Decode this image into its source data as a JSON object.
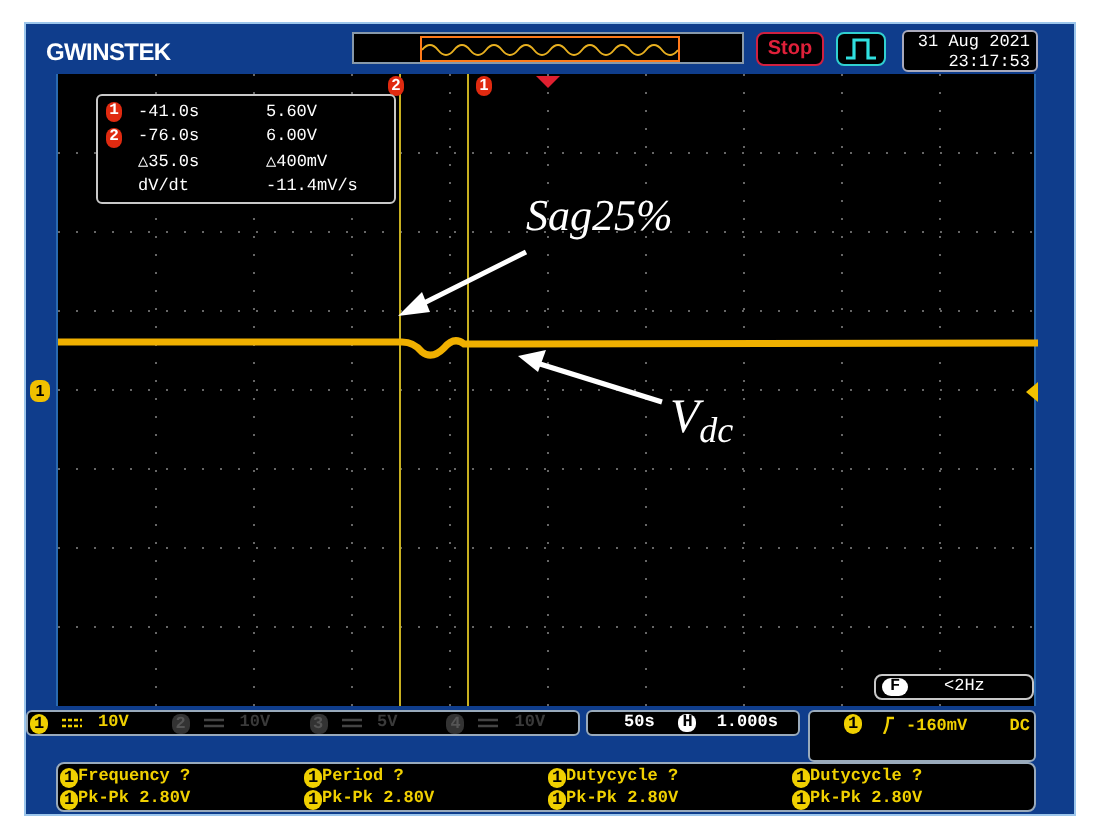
{
  "header": {
    "brand": "GWINSTEK",
    "run_state": "Stop",
    "date": "31 Aug 2021",
    "time": "23:17:53"
  },
  "screen": {
    "cursor_markers": [
      {
        "label": "2"
      },
      {
        "label": "1"
      }
    ],
    "channel_marker": "1",
    "cursor_readout": [
      {
        "marker": "1",
        "cells": [
          "-41.0s",
          "5.60V"
        ]
      },
      {
        "marker": "2",
        "cells": [
          "-76.0s",
          "6.00V"
        ]
      },
      {
        "cells": [
          "△35.0s",
          "△400mV"
        ]
      },
      {
        "cells": [
          "dV/dt",
          "-11.4mV/s"
        ]
      }
    ],
    "annotations": [
      "Sag25%",
      "V$_{dc}$"
    ],
    "frequency": {
      "label": "F",
      "value": "<2Hz"
    }
  },
  "channels": [
    {
      "number": "1",
      "scale": "10V",
      "enabled": true
    },
    {
      "number": "2",
      "scale": "10V",
      "enabled": false
    },
    {
      "number": "3",
      "scale": "5V",
      "enabled": false
    },
    {
      "number": "4",
      "scale": "10V",
      "enabled": false
    }
  ],
  "timebase": {
    "scale": "50s",
    "label": "H",
    "position": "1.000s"
  },
  "trigger": {
    "source": "1",
    "level": "-160mV",
    "coupling": "DC"
  },
  "measurements": [
    [
      {
        "channel": "1",
        "text": "Frequency ?"
      },
      {
        "channel": "1",
        "text": "Pk-Pk 2.80V"
      }
    ],
    [
      {
        "channel": "1",
        "text": "Period ?"
      },
      {
        "channel": "1",
        "text": "Pk-Pk 2.80V"
      }
    ],
    [
      {
        "channel": "1",
        "text": "Dutycycle ?"
      },
      {
        "channel": "1",
        "text": "Pk-Pk 2.80V"
      }
    ],
    [
      {
        "channel": "1",
        "text": "Dutycycle ?"
      },
      {
        "channel": "1",
        "text": "Pk-Pk 2.80V"
      }
    ]
  ]
}
